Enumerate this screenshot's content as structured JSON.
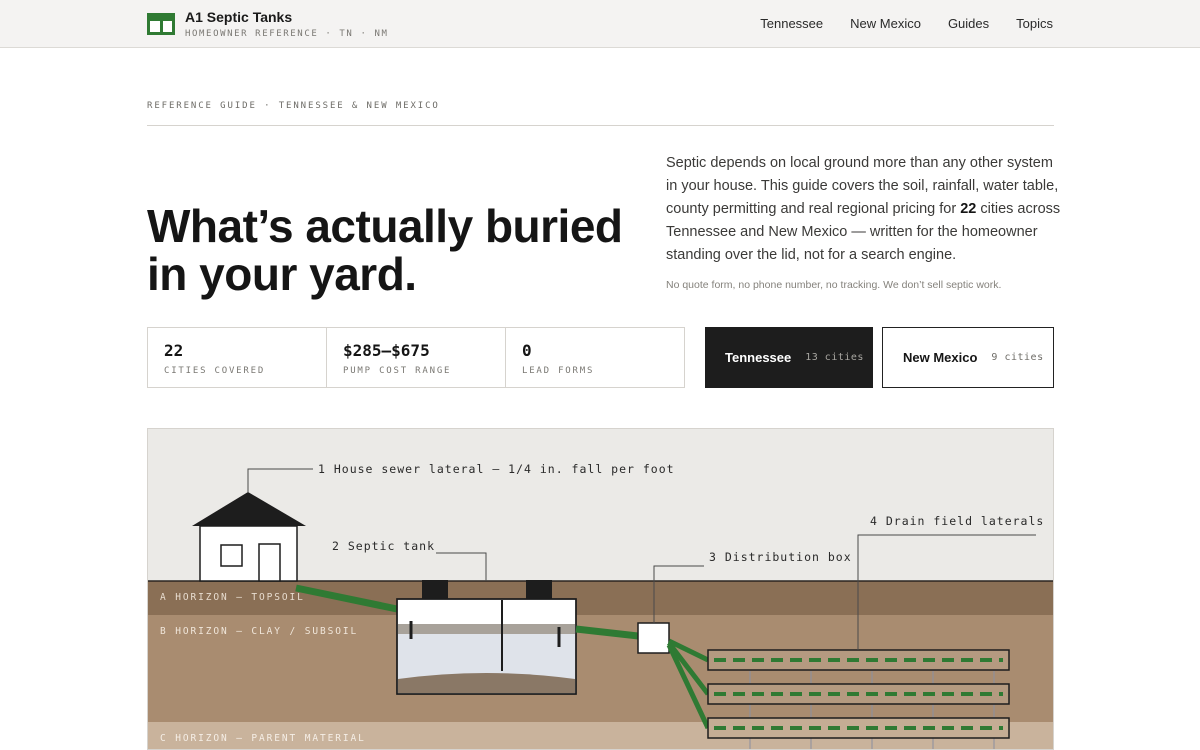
{
  "header": {
    "brand_name": "A1 Septic Tanks",
    "brand_tagline": "HOMEOWNER REFERENCE · TN · NM",
    "nav": [
      "Tennessee",
      "New Mexico",
      "Guides",
      "Topics"
    ]
  },
  "hero": {
    "eyebrow": "REFERENCE GUIDE · TENNESSEE & NEW MEXICO",
    "title_line1": "What’s actually buried",
    "title_line2": "in your yard.",
    "copy_before": "Septic depends on local ground more than any other system in your house. This guide covers the soil, rainfall, water table, county permitting and real regional pricing for ",
    "copy_count": "22",
    "copy_after": " cities across Tennessee and New Mexico — written for the homeowner standing over the lid, not for a search engine.",
    "note": "No quote form, no phone number, no tracking. We don’t sell septic work."
  },
  "stats": [
    {
      "value": "22",
      "label": "CITIES COVERED"
    },
    {
      "value": "$285–$675",
      "label": "PUMP COST RANGE"
    },
    {
      "value": "0",
      "label": "LEAD FORMS"
    }
  ],
  "states": [
    {
      "name": "Tennessee",
      "count": "13 cities"
    },
    {
      "name": "New Mexico",
      "count": "9 cities"
    }
  ],
  "diagram": {
    "callouts": [
      "1  House sewer lateral — 1/4 in. fall per foot",
      "2  Septic tank",
      "3  Distribution box",
      "4  Drain field laterals"
    ],
    "horizons": [
      "A HORIZON — TOPSOIL",
      "B HORIZON — CLAY / SUBSOIL",
      "C HORIZON — PARENT MATERIAL"
    ]
  },
  "colors": {
    "accent_green": "#2f7a33",
    "sky": "#ebeae7",
    "topsoil": "#8a6f55",
    "subsoil": "#a98c70",
    "parent_material": "#c9b39c"
  }
}
